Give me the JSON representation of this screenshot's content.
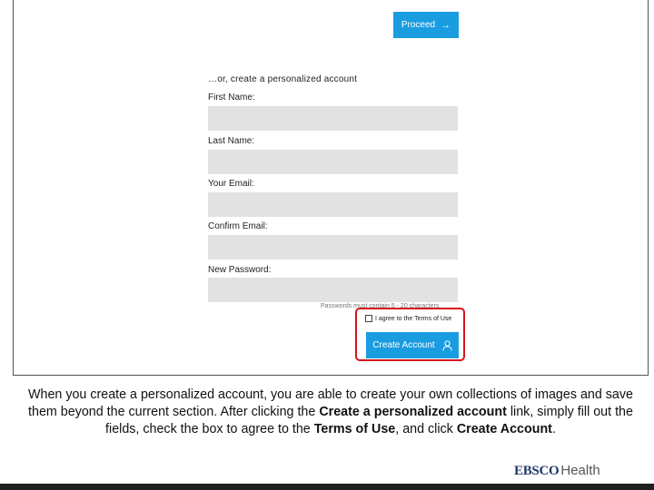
{
  "buttons": {
    "proceed": "Proceed",
    "create_account": "Create Account"
  },
  "form": {
    "heading": "…or, create a personalized account",
    "fields": [
      {
        "label": "First Name:",
        "value": ""
      },
      {
        "label": "Last Name:",
        "value": ""
      },
      {
        "label": "Your Email:",
        "value": ""
      },
      {
        "label": "Confirm Email:",
        "value": ""
      },
      {
        "label": "New Password:",
        "value": ""
      }
    ],
    "password_hint": "Passwords must contain 5 - 20 characters",
    "agree_text": "I agree to the Terms of Use"
  },
  "caption": {
    "part1": "When you create a personalized account, you are able to create your own collections of images and save them beyond the current section. After clicking the ",
    "bold1": "Create a personalized account",
    "part2": " link, simply fill out the fields, check the box to agree to the ",
    "bold2": "Terms of Use",
    "part3": ", and click ",
    "bold3": "Create Account",
    "part4": "."
  },
  "logo": {
    "ebsco": "EBSCO",
    "health": "Health"
  },
  "icons": {
    "proceed": "arrow-right-icon",
    "create": "user-icon"
  },
  "colors": {
    "button": "#1a9ce0",
    "highlight": "#d9121e",
    "field": "#e2e2e2"
  }
}
